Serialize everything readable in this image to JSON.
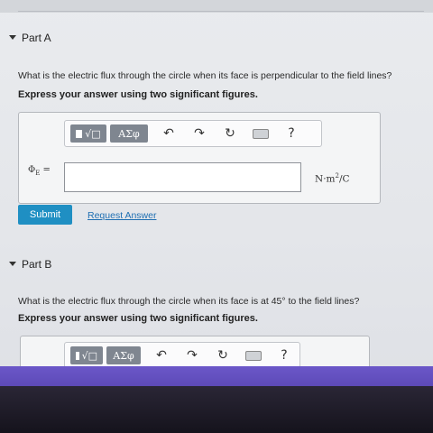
{
  "partA": {
    "header": "Part A",
    "question": "What is the electric flux through the circle when its face is perpendicular to the field lines?",
    "instruction": "Express your answer using two significant figures.",
    "toolbar": {
      "templates_label": "√□",
      "symbols_label": "ΑΣφ",
      "undo": "↶",
      "redo": "↷",
      "reset": "↻",
      "help": "?"
    },
    "variable_label": "Φ",
    "variable_sub": "E",
    "variable_eq": " =",
    "answer_value": "",
    "units_main": "N·m",
    "units_exp": "2",
    "units_tail": "/C",
    "submit_label": "Submit",
    "request_label": "Request Answer"
  },
  "partB": {
    "header": "Part B",
    "question": "What is the electric flux through the circle when its face is at 45° to the field lines?",
    "instruction": "Express your answer using two significant figures.",
    "toolbar": {
      "templates_label": "√□",
      "symbols_label": "ΑΣφ",
      "undo": "↶",
      "redo": "↷",
      "reset": "↻",
      "help": "?"
    }
  }
}
